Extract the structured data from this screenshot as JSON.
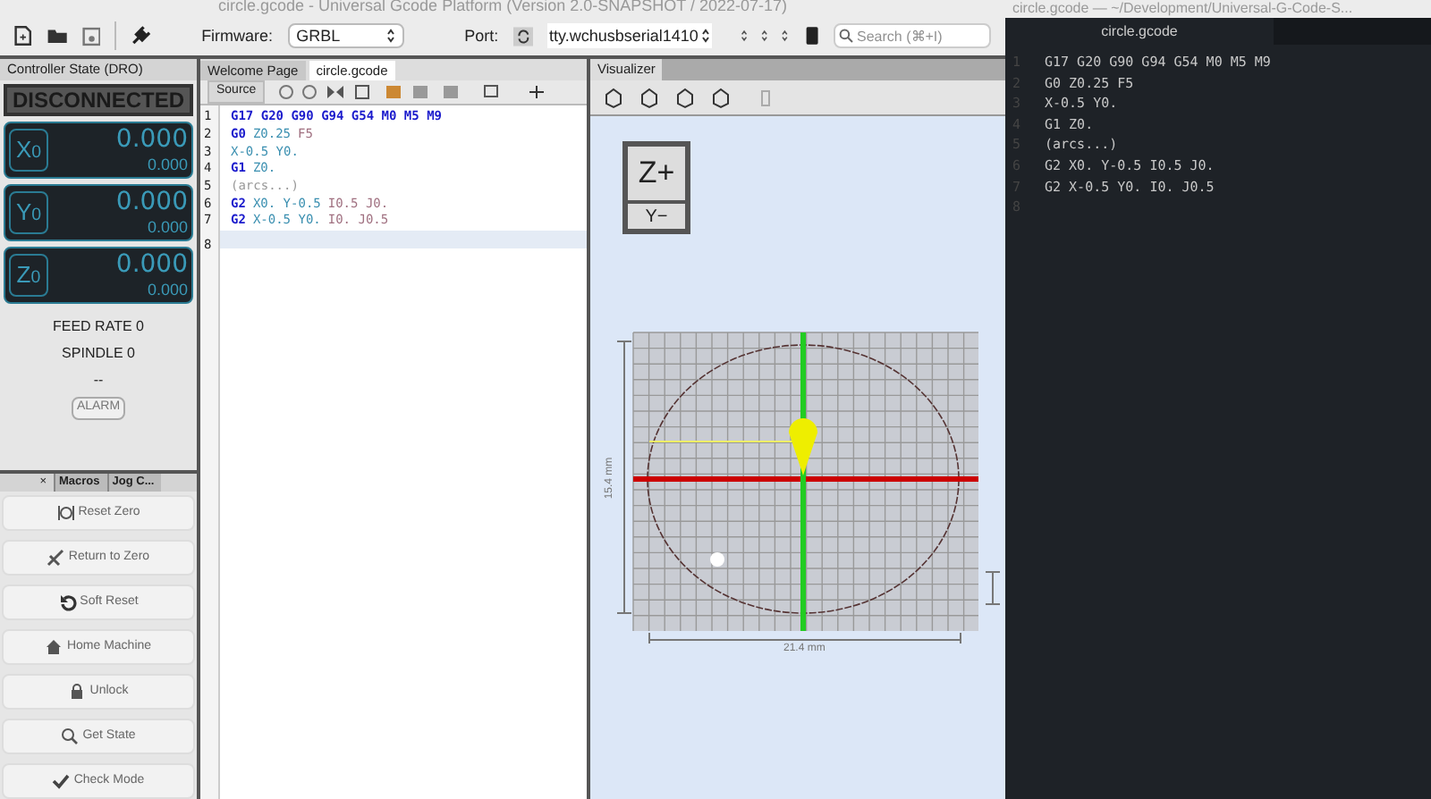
{
  "window": {
    "title": "circle.gcode - Universal Gcode Platform (Version 2.0-SNAPSHOT / 2022-07-17)"
  },
  "toolbar": {
    "firmware_label": "Firmware:",
    "firmware": "GRBL",
    "port_label": "Port:",
    "port": "tty.wchusbserial1410",
    "search": {
      "placeholder": "Search (⌘+I)"
    }
  },
  "dro_panel": {
    "title": "Controller State (DRO)",
    "status": "DISCONNECTED",
    "axes": [
      {
        "label": "X",
        "sub": "0",
        "work": "0.000",
        "machine": "0.000"
      },
      {
        "label": "Y",
        "sub": "0",
        "work": "0.000",
        "machine": "0.000"
      },
      {
        "label": "Z",
        "sub": "0",
        "work": "0.000",
        "machine": "0.000"
      }
    ],
    "feed_rate": "FEED RATE 0",
    "spindle": "SPINDLE 0",
    "state": "--",
    "alarm": "ALARM"
  },
  "actions_panel": {
    "tabs": [
      {
        "label": "×",
        "selected": true
      },
      {
        "label": "Macros",
        "selected": false
      },
      {
        "label": "Jog C...",
        "selected": false
      }
    ],
    "buttons": [
      {
        "label": "Reset Zero",
        "kind": "zero"
      },
      {
        "label": "Return to Zero",
        "kind": "return"
      },
      {
        "label": "Soft Reset",
        "kind": "reset"
      },
      {
        "label": "Home Machine",
        "kind": "home"
      },
      {
        "label": "Unlock",
        "kind": "unlock"
      },
      {
        "label": "Get State",
        "kind": "state"
      },
      {
        "label": "Check Mode",
        "kind": "check"
      }
    ]
  },
  "editor": {
    "tabs": [
      {
        "label": "Welcome Page",
        "selected": false
      },
      {
        "label": "circle.gcode",
        "selected": true
      }
    ],
    "source_button": "Source",
    "lines": [
      {
        "number": "1",
        "selected": false,
        "tokens": [
          {
            "text": "G17 G20 G90 G94 G54 M0 M5 M9",
            "kind": "command"
          }
        ]
      },
      {
        "number": "2",
        "selected": false,
        "tokens": [
          {
            "text": "G0",
            "kind": "command"
          },
          {
            "text": "Z0.25",
            "kind": "param"
          },
          {
            "text": "F5",
            "kind": "other"
          }
        ]
      },
      {
        "number": "3",
        "selected": false,
        "tokens": [
          {
            "text": "X-0.5 Y0.",
            "kind": "param"
          }
        ]
      },
      {
        "number": "4",
        "selected": false,
        "tokens": [
          {
            "text": "G1",
            "kind": "command"
          },
          {
            "text": "Z0.",
            "kind": "param"
          }
        ]
      },
      {
        "number": "5",
        "selected": false,
        "tokens": [
          {
            "text": "(arcs...)",
            "kind": "comment"
          }
        ]
      },
      {
        "number": "6",
        "selected": false,
        "tokens": [
          {
            "text": "G2",
            "kind": "command"
          },
          {
            "text": "X0. Y-0.5",
            "kind": "param"
          },
          {
            "text": "I0.5 J0.",
            "kind": "other"
          }
        ]
      },
      {
        "number": "7",
        "selected": false,
        "tokens": [
          {
            "text": "G2",
            "kind": "command"
          },
          {
            "text": "X-0.5 Y0.",
            "kind": "param"
          },
          {
            "text": "I0. J0.5",
            "kind": "other"
          }
        ]
      },
      {
        "number": "8",
        "selected": true
      }
    ]
  },
  "visualizer": {
    "title": "Visualizer",
    "cube_top": "Z+",
    "cube_front": "Y−",
    "height_label": "15.4 mm",
    "width_label": "21.4 mm"
  },
  "text_editor": {
    "title": "circle.gcode — ~/Development/Universal-G-Code-S...",
    "tab": "circle.gcode",
    "lines": [
      {
        "number": "1",
        "text": "G17 G20 G90 G94 G54 M0 M5 M9"
      },
      {
        "number": "2",
        "text": "G0 Z0.25 F5"
      },
      {
        "number": "3",
        "text": "X-0.5 Y0."
      },
      {
        "number": "4",
        "text": "G1 Z0."
      },
      {
        "number": "5",
        "text": "(arcs...)"
      },
      {
        "number": "6",
        "text": "G2 X0. Y-0.5 I0.5 J0."
      },
      {
        "number": "7",
        "text": "G2 X-0.5 Y0. I0. J0.5"
      },
      {
        "number": "8"
      }
    ]
  }
}
